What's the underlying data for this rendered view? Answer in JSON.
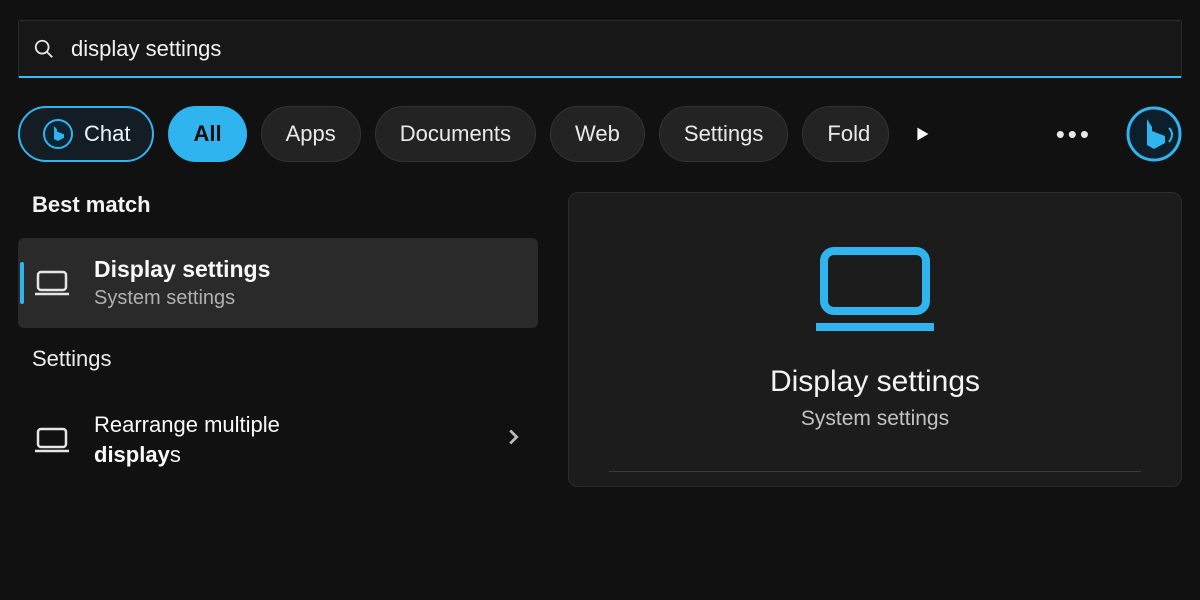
{
  "search": {
    "query": "display settings"
  },
  "filters": {
    "chat": "Chat",
    "all": "All",
    "apps": "Apps",
    "documents": "Documents",
    "web": "Web",
    "settings": "Settings",
    "folders": "Fold"
  },
  "sections": {
    "best_match": "Best match",
    "settings": "Settings"
  },
  "results": {
    "best_match": {
      "title": "Display settings",
      "subtitle": "System settings"
    },
    "settings_item": {
      "line1": "Rearrange multiple",
      "line2_bold": "display",
      "line2_rest": "s"
    }
  },
  "preview": {
    "title": "Display settings",
    "subtitle": "System settings"
  },
  "colors": {
    "accent": "#2fb4ef"
  }
}
